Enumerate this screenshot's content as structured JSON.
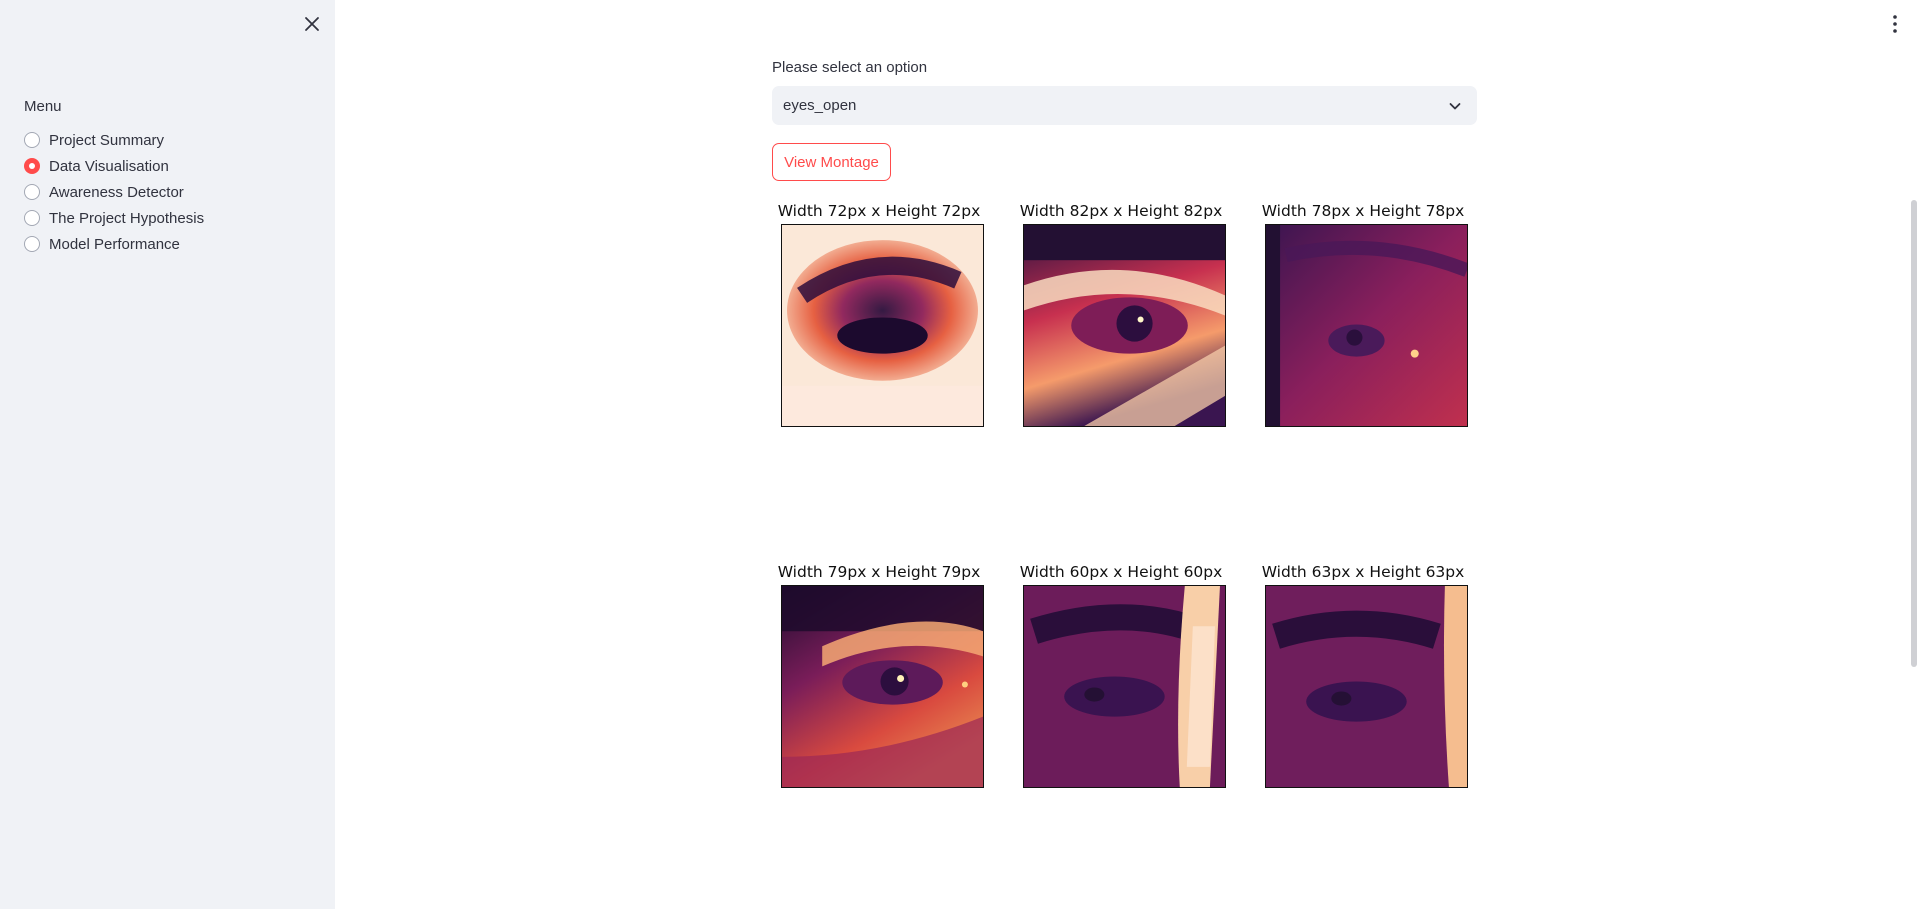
{
  "sidebar": {
    "menu_title": "Menu",
    "items": [
      {
        "label": "Project Summary",
        "selected": false
      },
      {
        "label": "Data Visualisation",
        "selected": true
      },
      {
        "label": "Awareness Detector",
        "selected": false
      },
      {
        "label": "The Project Hypothesis",
        "selected": false
      },
      {
        "label": "Model Performance",
        "selected": false
      }
    ]
  },
  "main": {
    "select": {
      "label": "Please select an option",
      "value": "eyes_open"
    },
    "montage_button": "View Montage",
    "images": [
      {
        "caption": "Width 72px x Height 72px"
      },
      {
        "caption": "Width 82px x Height 82px"
      },
      {
        "caption": "Width 78px x Height 78px"
      },
      {
        "caption": "Width 79px x Height 79px"
      },
      {
        "caption": "Width 60px x Height 60px"
      },
      {
        "caption": "Width 63px x Height 63px"
      }
    ]
  },
  "colors": {
    "accent": "#ff4b4b",
    "sidebar_bg": "#f0f2f6",
    "text": "#31333f"
  }
}
